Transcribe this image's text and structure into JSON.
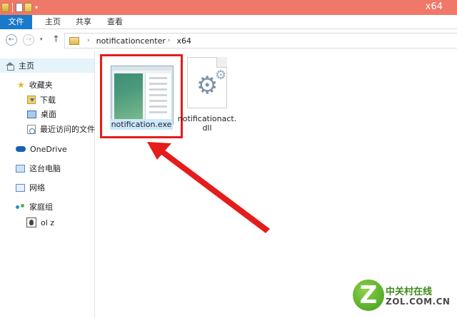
{
  "window": {
    "title": "x64"
  },
  "quick_access": {
    "icons": [
      "folder-icon",
      "properties-icon",
      "new-folder-icon"
    ],
    "dropdown": "▾"
  },
  "ribbon": {
    "tabs": [
      {
        "label": "文件"
      },
      {
        "label": "主页"
      },
      {
        "label": "共享"
      },
      {
        "label": "查看"
      }
    ]
  },
  "address_bar": {
    "back": "←",
    "forward": "→",
    "recent": "▾",
    "up": "↑",
    "segments": [
      "notificationcenter",
      "x64"
    ],
    "chevron": "›"
  },
  "sidebar": {
    "items": [
      {
        "label": "主页",
        "icon": "home-icon"
      },
      {
        "label": "收藏夹",
        "icon": "star-icon"
      },
      {
        "label": "下载",
        "icon": "downloads-icon"
      },
      {
        "label": "桌面",
        "icon": "desktop-icon"
      },
      {
        "label": "最近访问的文件夹",
        "icon": "recent-places-icon"
      },
      {
        "label": "OneDrive",
        "icon": "onedrive-icon"
      },
      {
        "label": "这台电脑",
        "icon": "this-pc-icon"
      },
      {
        "label": "网络",
        "icon": "network-icon"
      },
      {
        "label": "家庭组",
        "icon": "homegroup-icon"
      },
      {
        "label": "ol z",
        "icon": "user-icon"
      }
    ]
  },
  "files": [
    {
      "name": "notification.exe",
      "type": "application",
      "highlighted": true
    },
    {
      "name": "notificationact.dll",
      "type": "dll"
    }
  ],
  "annotation": {
    "highlight_color": "#e41c1c",
    "arrow_color": "#e41c1c"
  },
  "watermark": {
    "cn": "中关村在线",
    "en": "ZOL.COM.CN",
    "logo": "Z"
  },
  "colors": {
    "titlebar": "#f07868",
    "file_tab": "#1979ca",
    "selection": "#cce8ff"
  }
}
